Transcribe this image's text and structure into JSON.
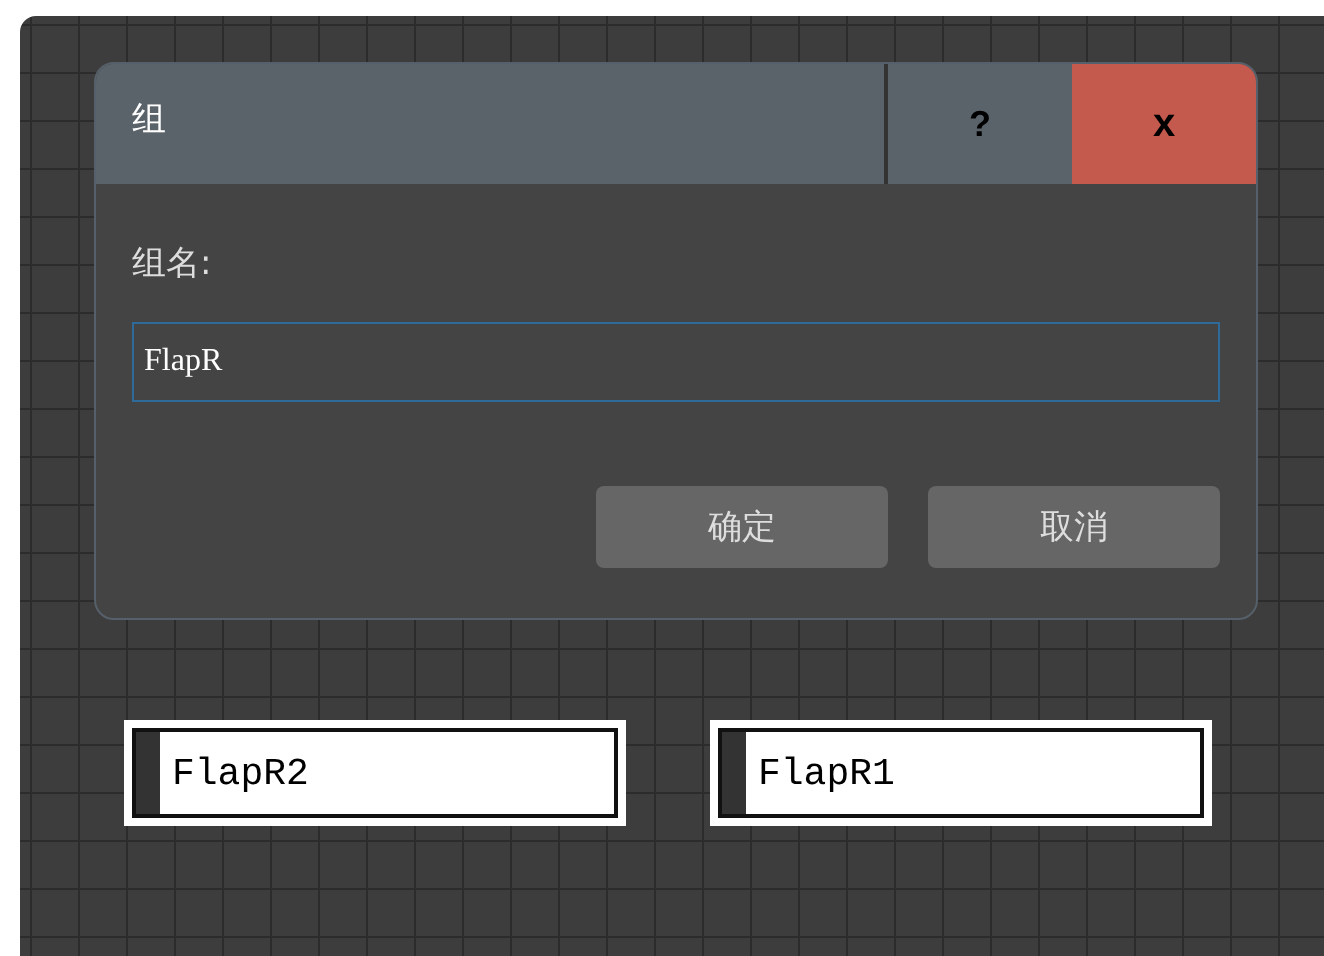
{
  "dialog": {
    "title": "组",
    "help_button": "?",
    "close_button": "x",
    "field_label": "组名:",
    "field_value": "FlapR",
    "buttons": [
      "确定",
      "取消"
    ]
  },
  "nodes": [
    {
      "label": "FlapR2"
    },
    {
      "label": "FlapR1"
    }
  ]
}
